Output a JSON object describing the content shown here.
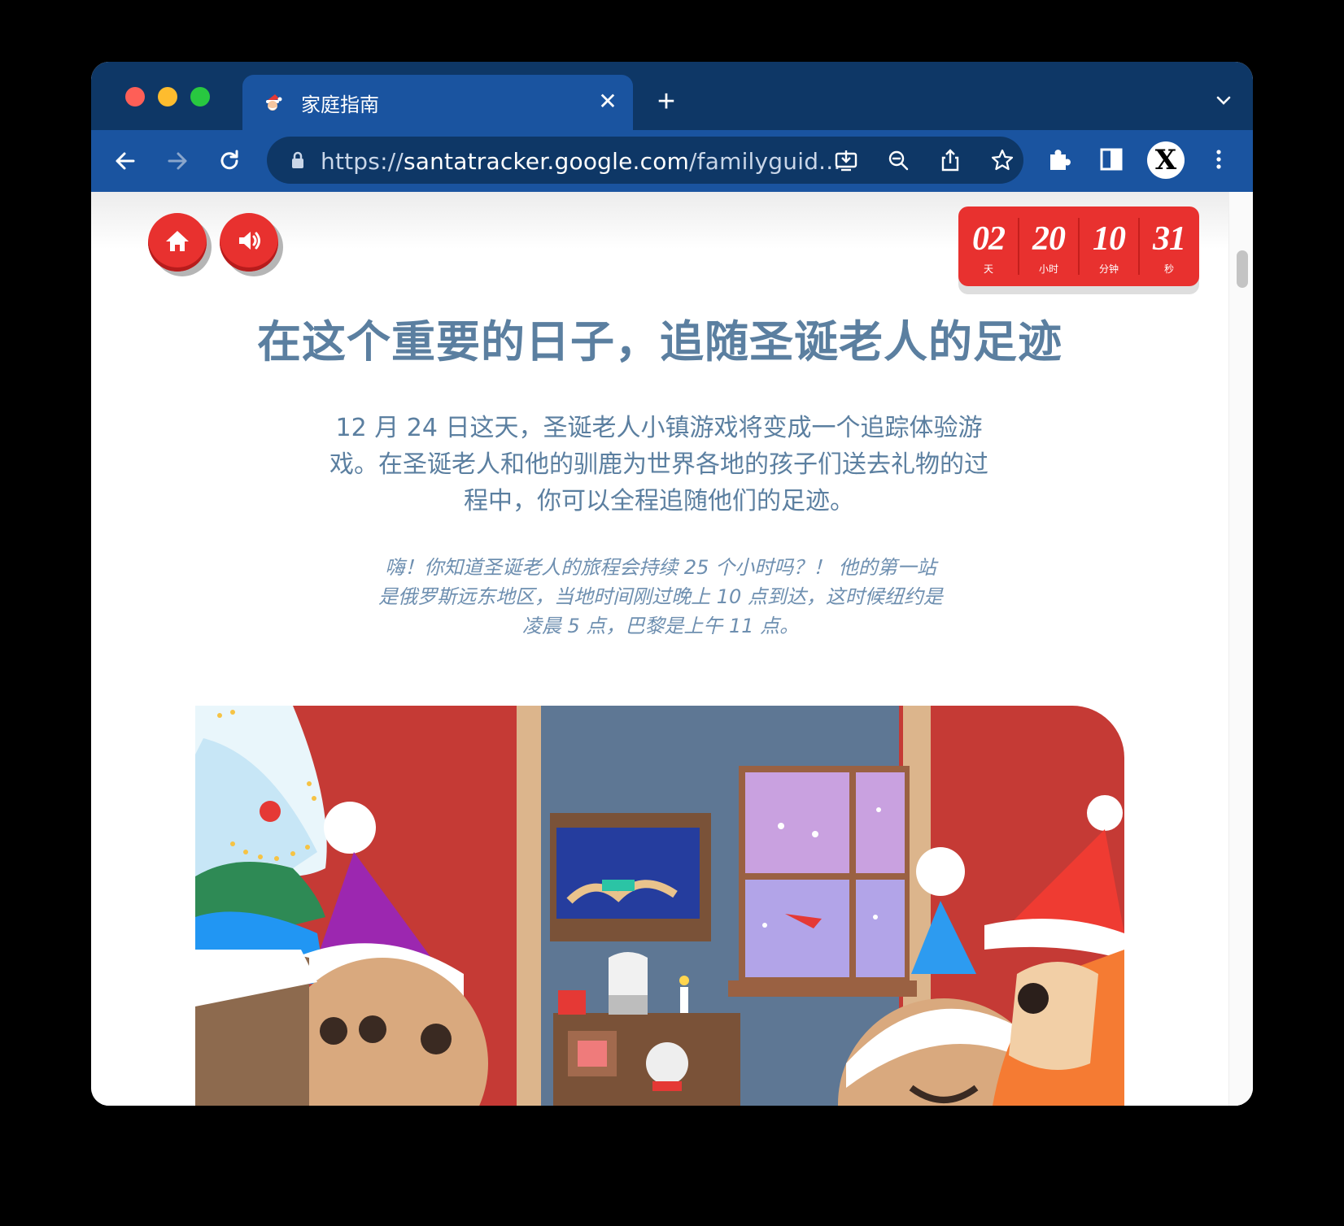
{
  "browser": {
    "tab_title": "家庭指南",
    "url_scheme": "https://",
    "url_host": "santatracker.google.com",
    "url_path": "/familyguid...",
    "profile_initial": "X"
  },
  "countdown": {
    "days": "02",
    "days_label": "天",
    "hours": "20",
    "hours_label": "小时",
    "minutes": "10",
    "minutes_label": "分钟",
    "seconds": "31",
    "seconds_label": "秒"
  },
  "page": {
    "headline": "在这个重要的日子，追随圣诞老人的足迹",
    "intro": "12 月 24 日这天，圣诞老人小镇游戏将变成一个追踪体验游戏。在圣诞老人和他的驯鹿为世界各地的孩子们送去礼物的过程中，你可以全程追随他们的足迹。",
    "fact": "嗨！你知道圣诞老人的旅程会持续 25 个小时吗？！ 他的第一站是俄罗斯远东地区，当地时间刚过晚上 10 点到达，这时候纽约是凌晨 5 点，巴黎是上午 11 点。"
  },
  "colors": {
    "tabstrip": "#0e3766",
    "toolbar": "#1a54a0",
    "brand_red": "#e8312f",
    "heading_blue": "#5b7fa0"
  },
  "icons": [
    "santa-favicon",
    "close-icon",
    "plus-icon",
    "chevron-down-icon",
    "back-arrow-icon",
    "forward-arrow-icon",
    "reload-icon",
    "lock-icon",
    "install-icon",
    "zoom-out-icon",
    "share-icon",
    "star-icon",
    "puzzle-icon",
    "sidebar-icon",
    "kebab-menu-icon",
    "home-icon",
    "speaker-icon"
  ]
}
